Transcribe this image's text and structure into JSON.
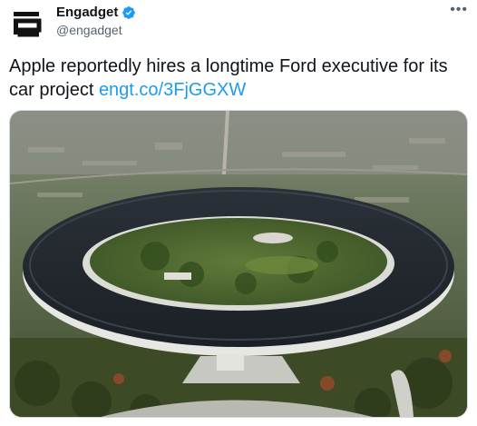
{
  "author": {
    "name": "Engadget",
    "handle": "@engadget",
    "avatar_icon": "engadget-logo-icon",
    "verified_icon": "verified-badge-icon",
    "verified_color": "#1d9bf0"
  },
  "more_icon": "more-options-icon",
  "tweet": {
    "text": "Apple reportedly hires a longtime Ford executive for its car project ",
    "link": "engt.co/3FjGGXW",
    "link_color": "#1d9bf0"
  },
  "media": {
    "image_icon": "apple-park-aerial-photo"
  }
}
